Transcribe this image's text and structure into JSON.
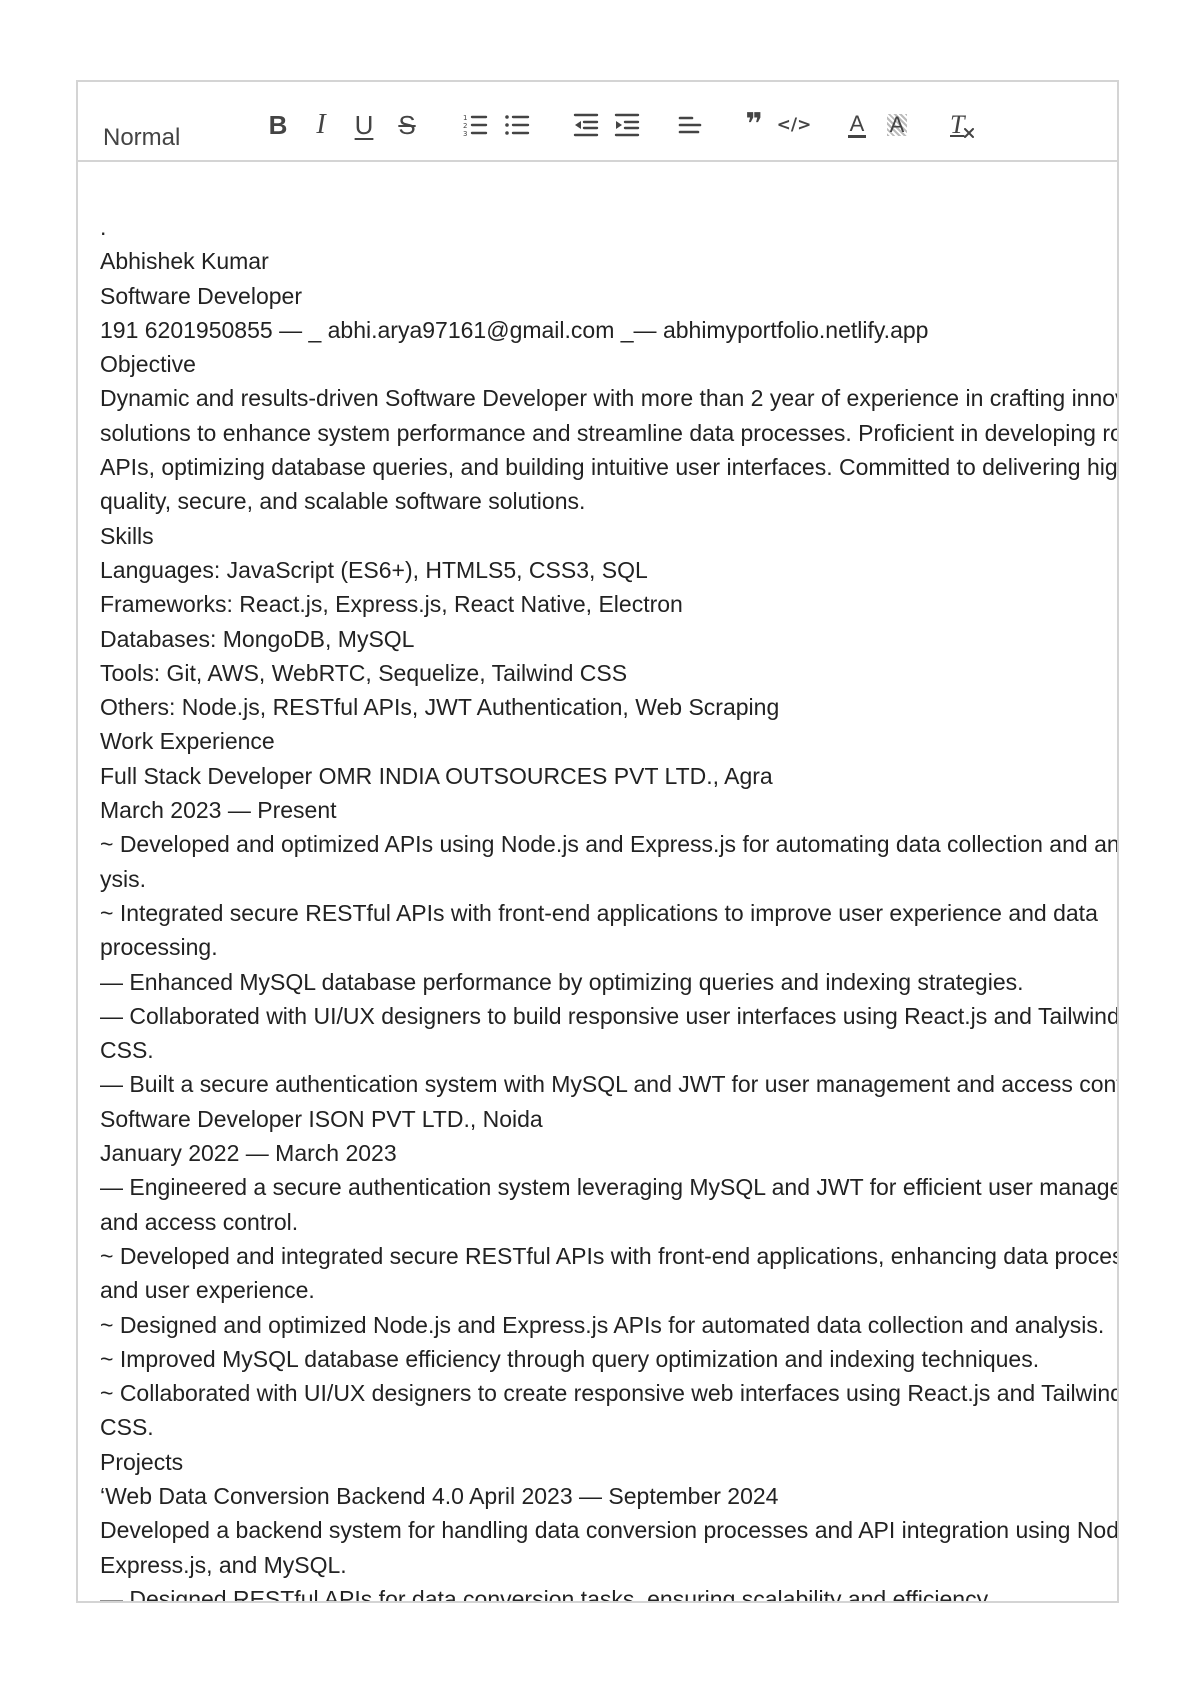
{
  "toolbar": {
    "header_select_value": "Normal",
    "buttons": [
      {
        "name": "bold-button",
        "icon": "bold-icon",
        "glyph": "B"
      },
      {
        "name": "italic-button",
        "icon": "italic-icon",
        "glyph": "I"
      },
      {
        "name": "underline-button",
        "icon": "underline-icon",
        "glyph": "U"
      },
      {
        "name": "strike-button",
        "icon": "strikethrough-icon",
        "glyph": "S"
      },
      {
        "name": "ordered-list-button",
        "icon": "ordered-list-icon"
      },
      {
        "name": "bullet-list-button",
        "icon": "bullet-list-icon"
      },
      {
        "name": "outdent-button",
        "icon": "outdent-icon"
      },
      {
        "name": "indent-button",
        "icon": "indent-icon"
      },
      {
        "name": "align-button",
        "icon": "align-icon"
      },
      {
        "name": "blockquote-button",
        "icon": "blockquote-icon",
        "glyph": "❞"
      },
      {
        "name": "code-block-button",
        "icon": "code-icon",
        "glyph": "</>"
      },
      {
        "name": "text-color-button",
        "icon": "text-color-icon",
        "glyph": "A"
      },
      {
        "name": "background-color-button",
        "icon": "background-color-icon",
        "glyph": "A"
      },
      {
        "name": "clear-format-button",
        "icon": "clear-format-icon",
        "glyph": "T"
      }
    ]
  },
  "colors": {
    "border": "#d4d4d4",
    "icon": "#444444",
    "text": "#222222"
  },
  "content": {
    "lines": [
      ".",
      "Abhishek Kumar",
      "Software Developer",
      "191 6201950855 — _ abhi.arya97161@gmail.com _— abhimyportfolio.netlify.app",
      "Objective",
      "Dynamic and results-driven Software Developer with more than 2 year of experience in crafting innovative",
      "solutions to enhance system performance and streamline data processes. Proficient in developing robust",
      "APIs, optimizing database queries, and building intuitive user interfaces. Committed to delivering high-",
      "quality, secure, and scalable software solutions.",
      "Skills",
      "Languages: JavaScript (ES6+), HTMLS5, CSS3, SQL",
      "Frameworks: React.js, Express.js, React Native, Electron",
      "Databases: MongoDB, MySQL",
      "Tools: Git, AWS, WebRTC, Sequelize, Tailwind CSS",
      "Others: Node.js, RESTful APIs, JWT Authentication, Web Scraping",
      "Work Experience",
      "Full Stack Developer OMR INDIA OUTSOURCES PVT LTD., Agra",
      "March 2023 — Present",
      "~ Developed and optimized APIs using Node.js and Express.js for automating data collection and anal-",
      "ysis.",
      "~ Integrated secure RESTful APIs with front-end applications to improve user experience and data",
      "processing.",
      "— Enhanced MySQL database performance by optimizing queries and indexing strategies.",
      "— Collaborated with UI/UX designers to build responsive user interfaces using React.js and Tailwind",
      "CSS.",
      "— Built a secure authentication system with MySQL and JWT for user management and access control.",
      "Software Developer ISON PVT LTD., Noida",
      "January 2022 — March 2023",
      "— Engineered a secure authentication system leveraging MySQL and JWT for efficient user management",
      "and access control.",
      "~ Developed and integrated secure RESTful APIs with front-end applications, enhancing data processing",
      "and user experience.",
      "~ Designed and optimized Node.js and Express.js APIs for automated data collection and analysis.",
      "~ Improved MySQL database efficiency through query optimization and indexing techniques.",
      "~ Collaborated with UI/UX designers to create responsive web interfaces using React.js and Tailwind",
      "CSS.",
      "Projects",
      "‘Web Data Conversion Backend 4.0 April 2023 — September 2024",
      "Developed a backend system for handling data conversion processes and API integration using Node.js,",
      "Express.js, and MySQL.",
      "— Designed RESTful APIs for data conversion tasks, ensuring scalability and efficiency."
    ]
  }
}
